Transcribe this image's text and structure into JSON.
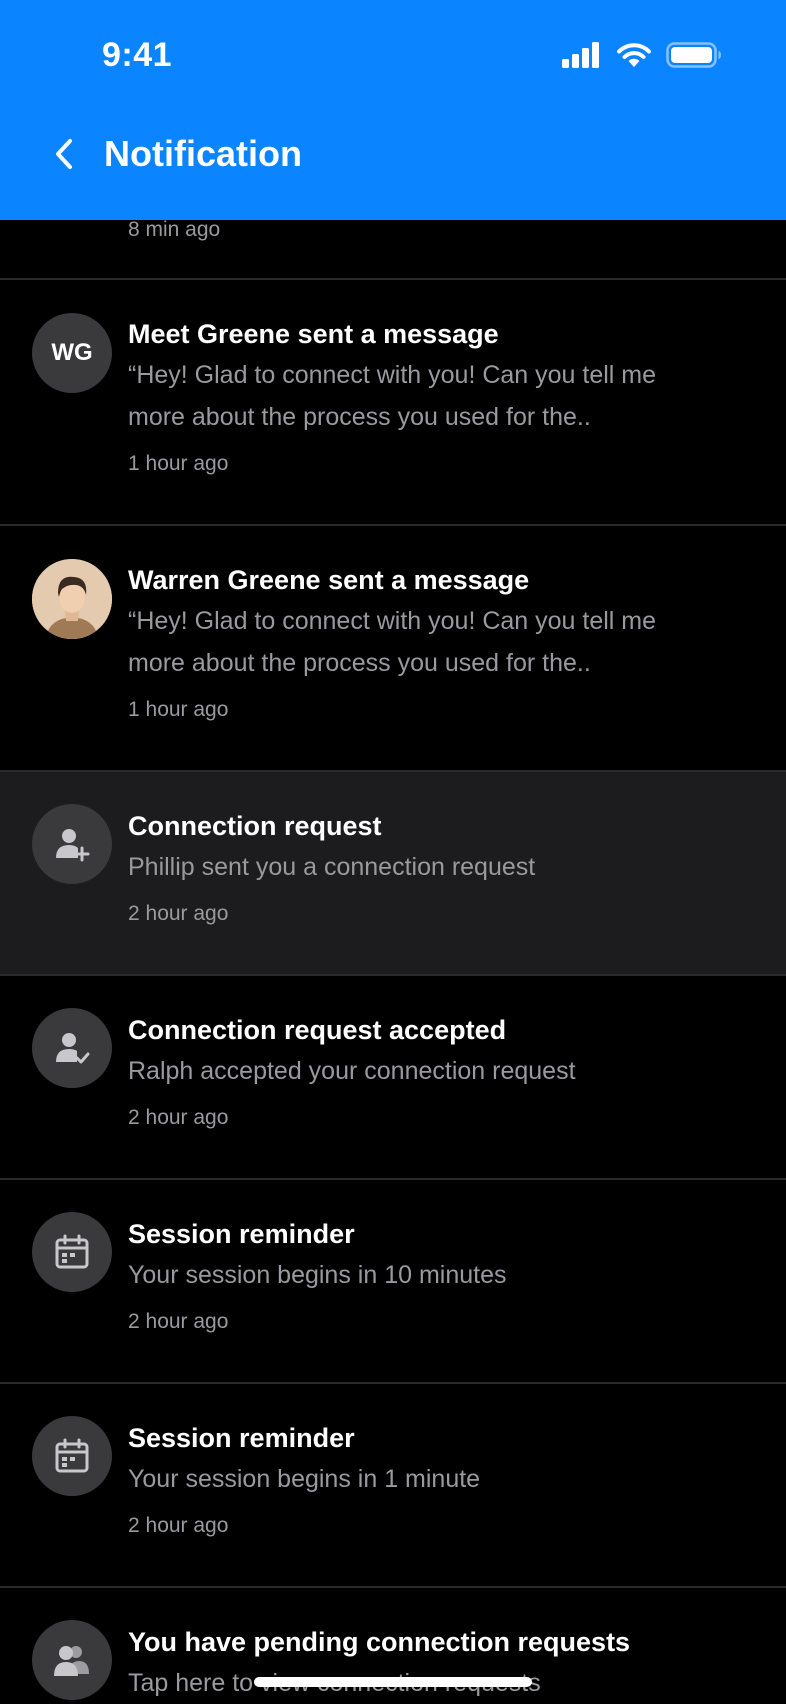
{
  "status_bar": {
    "time": "9:41"
  },
  "header": {
    "title": "Notification"
  },
  "partial_item": {
    "time": "8 min ago"
  },
  "notifications": [
    {
      "avatar_initials": "WG",
      "title": "Meet Greene sent a message",
      "body_line1": "“Hey! Glad to connect with you! Can you tell me",
      "body_line2": "more about the process you used for the..",
      "time": "1 hour ago"
    },
    {
      "title": "Warren Greene sent a message",
      "body_line1": "“Hey! Glad to connect with you! Can you tell me",
      "body_line2": "more about the process you used for the..",
      "time": "1 hour ago"
    },
    {
      "title": "Connection request",
      "body": "Phillip sent you a connection request",
      "time": "2 hour ago"
    },
    {
      "title": "Connection request accepted",
      "body": "Ralph accepted your connection request",
      "time": "2 hour ago"
    },
    {
      "title": "Session reminder",
      "body": "Your session begins in 10 minutes",
      "time": "2 hour ago"
    },
    {
      "title": "Session reminder",
      "body": "Your session begins in 1 minute",
      "time": "2 hour ago"
    },
    {
      "title": "You have pending connection requests",
      "body": "Tap here to view connection requests"
    }
  ],
  "colors": {
    "header": "#0A84FF",
    "background": "#000000",
    "highlight": "#1C1C1E",
    "avatar": "#3A3A3C",
    "secondary_text": "#9A9A9E"
  }
}
